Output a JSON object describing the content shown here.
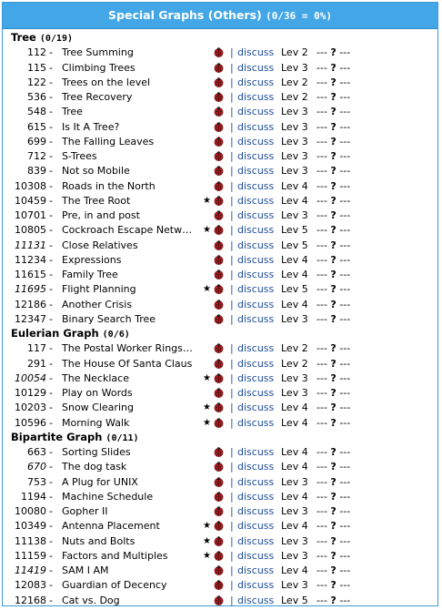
{
  "header": {
    "title": "Special Graphs (Others)",
    "count": "(0/36 = 0%)"
  },
  "colors": {
    "header_bg": "#43a6e6",
    "link": "#1e4d9b",
    "ladybug": "#c0141a"
  },
  "icons": {
    "solved_status": "ladybug-icon",
    "star": "star-icon"
  },
  "sections": [
    {
      "name": "Tree",
      "count": "(0/19)",
      "problems": [
        {
          "id": "112",
          "name": "Tree Summing",
          "italic": false,
          "star": false,
          "link": "discuss",
          "level": "Lev 2",
          "rank": "---",
          "mark": "?",
          "rank2": "---"
        },
        {
          "id": "115",
          "name": "Climbing Trees",
          "italic": false,
          "star": false,
          "link": "discuss",
          "level": "Lev 3",
          "rank": "---",
          "mark": "?",
          "rank2": "---"
        },
        {
          "id": "122",
          "name": "Trees on the level",
          "italic": false,
          "star": false,
          "link": "discuss",
          "level": "Lev 2",
          "rank": "---",
          "mark": "?",
          "rank2": "---"
        },
        {
          "id": "536",
          "name": "Tree Recovery",
          "italic": false,
          "star": false,
          "link": "discuss",
          "level": "Lev 2",
          "rank": "---",
          "mark": "?",
          "rank2": "---"
        },
        {
          "id": "548",
          "name": "Tree",
          "italic": false,
          "star": false,
          "link": "discuss",
          "level": "Lev 3",
          "rank": "---",
          "mark": "?",
          "rank2": "---"
        },
        {
          "id": "615",
          "name": "Is It A Tree?",
          "italic": false,
          "star": false,
          "link": "discuss",
          "level": "Lev 3",
          "rank": "---",
          "mark": "?",
          "rank2": "---"
        },
        {
          "id": "699",
          "name": "The Falling Leaves",
          "italic": false,
          "star": false,
          "link": "discuss",
          "level": "Lev 3",
          "rank": "---",
          "mark": "?",
          "rank2": "---"
        },
        {
          "id": "712",
          "name": "S-Trees",
          "italic": false,
          "star": false,
          "link": "discuss",
          "level": "Lev 3",
          "rank": "---",
          "mark": "?",
          "rank2": "---"
        },
        {
          "id": "839",
          "name": "Not so Mobile",
          "italic": false,
          "star": false,
          "link": "discuss",
          "level": "Lev 3",
          "rank": "---",
          "mark": "?",
          "rank2": "---"
        },
        {
          "id": "10308",
          "name": "Roads in the North",
          "italic": false,
          "star": false,
          "link": "discuss",
          "level": "Lev 4",
          "rank": "---",
          "mark": "?",
          "rank2": "---"
        },
        {
          "id": "10459",
          "name": "The Tree Root",
          "italic": false,
          "star": true,
          "link": "discuss",
          "level": "Lev 4",
          "rank": "---",
          "mark": "?",
          "rank2": "---"
        },
        {
          "id": "10701",
          "name": "Pre, in and post",
          "italic": false,
          "star": false,
          "link": "discuss",
          "level": "Lev 3",
          "rank": "---",
          "mark": "?",
          "rank2": "---"
        },
        {
          "id": "10805",
          "name": "Cockroach Escape Netw…",
          "italic": false,
          "star": true,
          "link": "discuss",
          "level": "Lev 5",
          "rank": "---",
          "mark": "?",
          "rank2": "---"
        },
        {
          "id": "11131",
          "name": "Close Relatives",
          "italic": true,
          "star": false,
          "link": "discuss",
          "level": "Lev 5",
          "rank": "---",
          "mark": "?",
          "rank2": "---"
        },
        {
          "id": "11234",
          "name": "Expressions",
          "italic": false,
          "star": false,
          "link": "discuss",
          "level": "Lev 4",
          "rank": "---",
          "mark": "?",
          "rank2": "---"
        },
        {
          "id": "11615",
          "name": "Family Tree",
          "italic": false,
          "star": false,
          "link": "discuss",
          "level": "Lev 4",
          "rank": "---",
          "mark": "?",
          "rank2": "---"
        },
        {
          "id": "11695",
          "name": "Flight Planning",
          "italic": true,
          "star": true,
          "link": "discuss",
          "level": "Lev 5",
          "rank": "---",
          "mark": "?",
          "rank2": "---"
        },
        {
          "id": "12186",
          "name": "Another Crisis",
          "italic": false,
          "star": false,
          "link": "discuss",
          "level": "Lev 4",
          "rank": "---",
          "mark": "?",
          "rank2": "---"
        },
        {
          "id": "12347",
          "name": "Binary Search Tree",
          "italic": false,
          "star": false,
          "link": "discuss",
          "level": "Lev 3",
          "rank": "---",
          "mark": "?",
          "rank2": "---"
        }
      ]
    },
    {
      "name": "Eulerian Graph",
      "count": "(0/6)",
      "problems": [
        {
          "id": "117",
          "name": "The Postal Worker Rings…",
          "italic": false,
          "star": false,
          "link": "discuss",
          "level": "Lev 2",
          "rank": "---",
          "mark": "?",
          "rank2": "---"
        },
        {
          "id": "291",
          "name": "The House Of Santa Claus",
          "italic": false,
          "star": false,
          "link": "discuss",
          "level": "Lev 2",
          "rank": "---",
          "mark": "?",
          "rank2": "---"
        },
        {
          "id": "10054",
          "name": "The Necklace",
          "italic": true,
          "star": true,
          "link": "discuss",
          "level": "Lev 3",
          "rank": "---",
          "mark": "?",
          "rank2": "---"
        },
        {
          "id": "10129",
          "name": "Play on Words",
          "italic": false,
          "star": false,
          "link": "discuss",
          "level": "Lev 3",
          "rank": "---",
          "mark": "?",
          "rank2": "---"
        },
        {
          "id": "10203",
          "name": "Snow Clearing",
          "italic": false,
          "star": true,
          "link": "discuss",
          "level": "Lev 4",
          "rank": "---",
          "mark": "?",
          "rank2": "---"
        },
        {
          "id": "10596",
          "name": "Morning Walk",
          "italic": false,
          "star": true,
          "link": "discuss",
          "level": "Lev 4",
          "rank": "---",
          "mark": "?",
          "rank2": "---"
        }
      ]
    },
    {
      "name": "Bipartite Graph",
      "count": "(0/11)",
      "problems": [
        {
          "id": "663",
          "name": "Sorting Slides",
          "italic": false,
          "star": false,
          "link": "discuss",
          "level": "Lev 4",
          "rank": "---",
          "mark": "?",
          "rank2": "---"
        },
        {
          "id": "670",
          "name": "The dog task",
          "italic": true,
          "star": false,
          "link": "discuss",
          "level": "Lev 4",
          "rank": "---",
          "mark": "?",
          "rank2": "---"
        },
        {
          "id": "753",
          "name": "A Plug for UNIX",
          "italic": false,
          "star": false,
          "link": "discuss",
          "level": "Lev 3",
          "rank": "---",
          "mark": "?",
          "rank2": "---"
        },
        {
          "id": "1194",
          "name": "Machine Schedule",
          "italic": false,
          "star": false,
          "link": "discuss",
          "level": "Lev 4",
          "rank": "---",
          "mark": "?",
          "rank2": "---"
        },
        {
          "id": "10080",
          "name": "Gopher II",
          "italic": false,
          "star": false,
          "link": "discuss",
          "level": "Lev 3",
          "rank": "---",
          "mark": "?",
          "rank2": "---"
        },
        {
          "id": "10349",
          "name": "Antenna Placement",
          "italic": false,
          "star": true,
          "link": "discuss",
          "level": "Lev 4",
          "rank": "---",
          "mark": "?",
          "rank2": "---"
        },
        {
          "id": "11138",
          "name": "Nuts and Bolts",
          "italic": false,
          "star": true,
          "link": "discuss",
          "level": "Lev 3",
          "rank": "---",
          "mark": "?",
          "rank2": "---"
        },
        {
          "id": "11159",
          "name": "Factors and Multiples",
          "italic": false,
          "star": true,
          "link": "discuss",
          "level": "Lev 3",
          "rank": "---",
          "mark": "?",
          "rank2": "---"
        },
        {
          "id": "11419",
          "name": "SAM I AM",
          "italic": true,
          "star": false,
          "link": "discuss",
          "level": "Lev 4",
          "rank": "---",
          "mark": "?",
          "rank2": "---"
        },
        {
          "id": "12083",
          "name": "Guardian of Decency",
          "italic": false,
          "star": false,
          "link": "discuss",
          "level": "Lev 3",
          "rank": "---",
          "mark": "?",
          "rank2": "---"
        },
        {
          "id": "12168",
          "name": "Cat vs. Dog",
          "italic": false,
          "star": false,
          "link": "discuss",
          "level": "Lev 5",
          "rank": "---",
          "mark": "?",
          "rank2": "---"
        }
      ]
    }
  ]
}
